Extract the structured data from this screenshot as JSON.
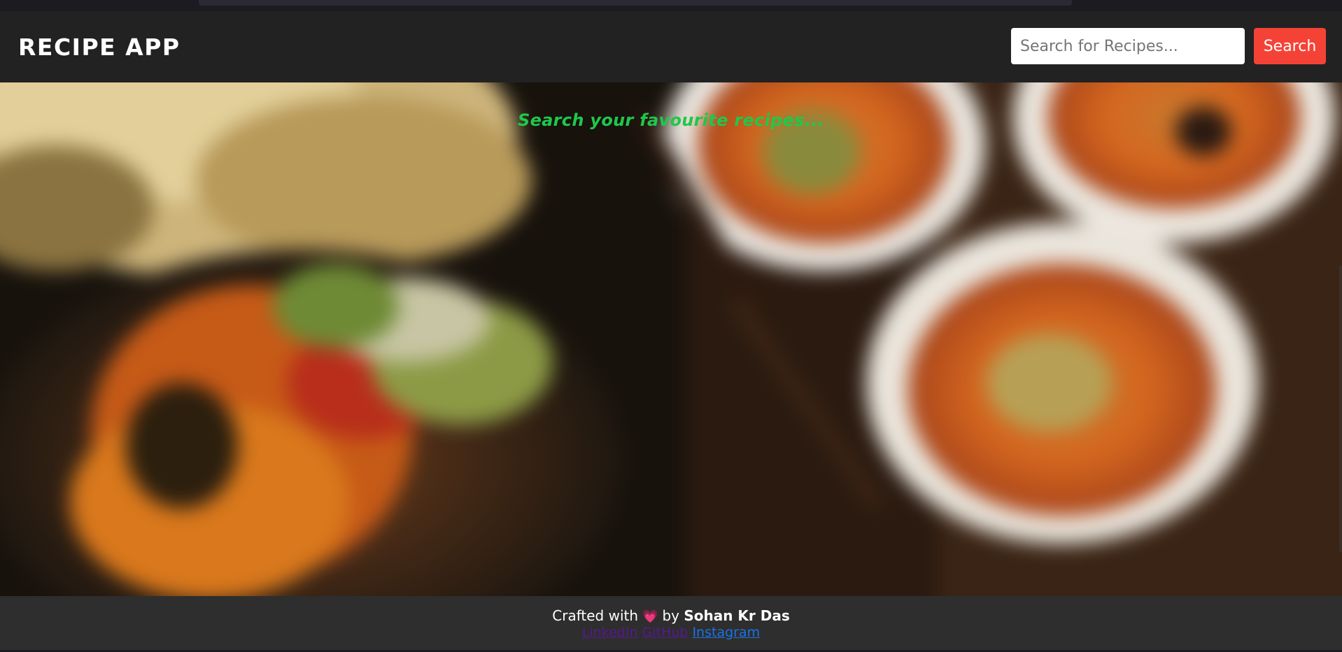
{
  "app": {
    "brand": "RECIPE APP"
  },
  "search": {
    "placeholder": "Search for Recipes...",
    "value": "",
    "button_label": "Search"
  },
  "hero": {
    "tagline": "Search your favourite recipes..."
  },
  "footer": {
    "crafted_prefix": "Crafted with",
    "heart_icon": "heart-icon",
    "by_label": "by",
    "author": "Sohan Kr Das",
    "links": {
      "linkedin": "LinkedIn",
      "github": "GitHub",
      "instagram": "Instagram"
    }
  },
  "colors": {
    "navbar_bg": "#222222",
    "search_button": "#f44336",
    "tagline": "#1fc84a",
    "footer_bg": "#2e2e2e",
    "heart": "#f0508c",
    "visited_link": "#551a8b",
    "unvisited_link": "#1a73e8"
  }
}
